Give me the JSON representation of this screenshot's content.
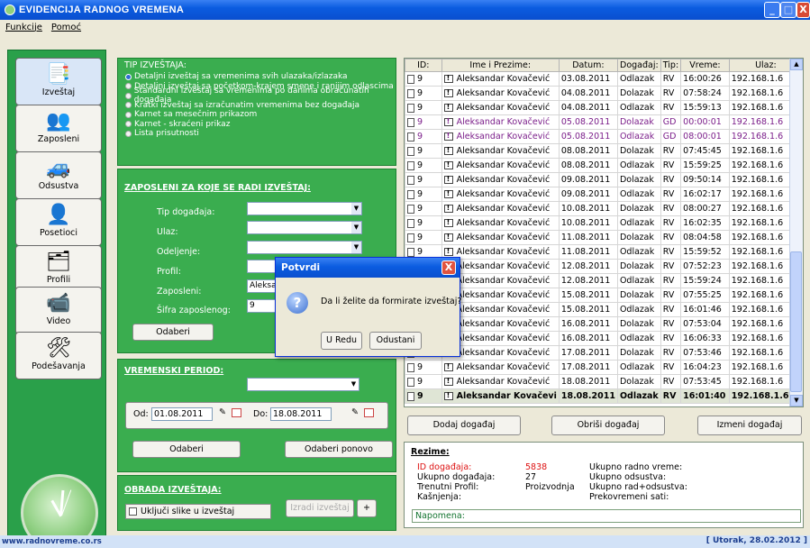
{
  "window": {
    "title": "EVIDENCIJA RADNOG VREMENA",
    "min": "_",
    "max": "□",
    "close": "X"
  },
  "menu": [
    "Funkcije",
    "Pomoć"
  ],
  "nav": [
    {
      "label": "Izveštaj",
      "icon": "📑"
    },
    {
      "label": "Zaposleni",
      "icon": "👥"
    },
    {
      "label": "Odsustva",
      "icon": "🚙"
    },
    {
      "label": "Posetioci",
      "icon": "👤"
    },
    {
      "label": "Profili",
      "icon": "🗂"
    },
    {
      "label": "Video",
      "icon": "📹"
    },
    {
      "label": "Podešavanja",
      "icon": "🛠"
    }
  ],
  "report_type": {
    "title": "TIP IZVEŠTAJA:",
    "options": [
      "Detaljni izveštaj sa vremenima svih ulazaka/izlazaka",
      "Detaljni izveštaj sa početkom-krajem smene i ranijim odlascima",
      "Standardni izveštaj sa vremenima po danima obračunatih događaja",
      "Kratki izveštaj sa izračunatim vremenima bez događaja",
      "Karnet sa mesečnim prikazom",
      "Karnet - skraćeni prikaz",
      "Lista prisutnosti"
    ],
    "selected_index": 0
  },
  "employees": {
    "header": "ZAPOSLENI ZA KOJE SE RADI IZVEŠTAJ:",
    "fields": [
      {
        "label": "Tip događaja:",
        "value": ""
      },
      {
        "label": "Ulaz:",
        "value": ""
      },
      {
        "label": "Odeljenje:",
        "value": ""
      },
      {
        "label": "Profil:",
        "value": ""
      },
      {
        "label": "Zaposleni:",
        "value": "Aleksan"
      },
      {
        "label": "Šifra zaposlenog:",
        "value": "9"
      }
    ],
    "select_button": "Odaberi"
  },
  "period": {
    "header": "VREMENSKI PERIOD:",
    "from_label": "Od:",
    "from": "01.08.2011",
    "to_label": "Do:",
    "to": "18.08.2011",
    "select_button": "Odaberi",
    "reselect_button": "Odaberi ponovo"
  },
  "processing": {
    "header": "OBRADA IZVEŠTAJA:",
    "checkbox_label": "Uključi slike u izveštaj",
    "make_button": "Izradi izveštaj",
    "plus_button": "+"
  },
  "events_table": {
    "columns": [
      "ID:",
      "Ime i Prezime:",
      "Datum:",
      "Događaj:",
      "Tip:",
      "Vreme:",
      "Ulaz:"
    ],
    "rows": [
      [
        "9",
        "Aleksandar Kovačević",
        "03.08.2011",
        "Odlazak",
        "RV",
        "16:00:26",
        "192.168.1.6"
      ],
      [
        "9",
        "Aleksandar Kovačević",
        "04.08.2011",
        "Dolazak",
        "RV",
        "07:58:24",
        "192.168.1.6"
      ],
      [
        "9",
        "Aleksandar Kovačević",
        "04.08.2011",
        "Odlazak",
        "RV",
        "15:59:13",
        "192.168.1.6"
      ],
      [
        "9",
        "Aleksandar Kovačević",
        "05.08.2011",
        "Dolazak",
        "GD",
        "00:00:01",
        "192.168.1.6"
      ],
      [
        "9",
        "Aleksandar Kovačević",
        "05.08.2011",
        "Odlazak",
        "GD",
        "08:00:01",
        "192.168.1.6"
      ],
      [
        "9",
        "Aleksandar Kovačević",
        "08.08.2011",
        "Dolazak",
        "RV",
        "07:45:45",
        "192.168.1.6"
      ],
      [
        "9",
        "Aleksandar Kovačević",
        "08.08.2011",
        "Odlazak",
        "RV",
        "15:59:25",
        "192.168.1.6"
      ],
      [
        "9",
        "Aleksandar Kovačević",
        "09.08.2011",
        "Dolazak",
        "RV",
        "09:50:14",
        "192.168.1.6"
      ],
      [
        "9",
        "Aleksandar Kovačević",
        "09.08.2011",
        "Odlazak",
        "RV",
        "16:02:17",
        "192.168.1.6"
      ],
      [
        "9",
        "Aleksandar Kovačević",
        "10.08.2011",
        "Dolazak",
        "RV",
        "08:00:27",
        "192.168.1.6"
      ],
      [
        "9",
        "Aleksandar Kovačević",
        "10.08.2011",
        "Odlazak",
        "RV",
        "16:02:35",
        "192.168.1.6"
      ],
      [
        "9",
        "Aleksandar Kovačević",
        "11.08.2011",
        "Dolazak",
        "RV",
        "08:04:58",
        "192.168.1.6"
      ],
      [
        "9",
        "Aleksandar Kovačević",
        "11.08.2011",
        "Odlazak",
        "RV",
        "15:59:52",
        "192.168.1.6"
      ],
      [
        "9",
        "Aleksandar Kovačević",
        "12.08.2011",
        "Dolazak",
        "RV",
        "07:52:23",
        "192.168.1.6"
      ],
      [
        "9",
        "Aleksandar Kovačević",
        "12.08.2011",
        "Odlazak",
        "RV",
        "15:59:24",
        "192.168.1.6"
      ],
      [
        "9",
        "Aleksandar Kovačević",
        "15.08.2011",
        "Dolazak",
        "RV",
        "07:55:25",
        "192.168.1.6"
      ],
      [
        "9",
        "Aleksandar Kovačević",
        "15.08.2011",
        "Odlazak",
        "RV",
        "16:01:46",
        "192.168.1.6"
      ],
      [
        "9",
        "Aleksandar Kovačević",
        "16.08.2011",
        "Dolazak",
        "RV",
        "07:53:04",
        "192.168.1.6"
      ],
      [
        "9",
        "Aleksandar Kovačević",
        "16.08.2011",
        "Odlazak",
        "RV",
        "16:06:33",
        "192.168.1.6"
      ],
      [
        "9",
        "Aleksandar Kovačević",
        "17.08.2011",
        "Dolazak",
        "RV",
        "07:53:46",
        "192.168.1.6"
      ],
      [
        "9",
        "Aleksandar Kovačević",
        "17.08.2011",
        "Odlazak",
        "RV",
        "16:04:23",
        "192.168.1.6"
      ],
      [
        "9",
        "Aleksandar Kovačević",
        "18.08.2011",
        "Dolazak",
        "RV",
        "07:53:45",
        "192.168.1.6"
      ],
      [
        "9",
        "Aleksandar Kovačevi",
        "18.08.2011",
        "Odlazak",
        "RV",
        "16:01:40",
        "192.168.1.6"
      ]
    ],
    "purple_rows": [
      3,
      4
    ],
    "selected_row": 22
  },
  "event_buttons": {
    "add": "Dodaj događaj",
    "delete": "Obriši događaj",
    "edit": "Izmeni događaj"
  },
  "summary": {
    "title": "Rezime:",
    "id_label": "ID događaja:",
    "id_value": "5838",
    "count_label": "Ukupno događaja:",
    "count_value": "27",
    "profile_label": "Trenutni Profil:",
    "profile_value": "Proizvodnja",
    "late_label": "Kašnjenja:",
    "work_label": "Ukupno radno vreme:",
    "absence_label": "Ukupno odsustva:",
    "work_absence_label": "Ukupno rad+odsustva:",
    "overtime_label": "Prekovremeni sati:",
    "note_label": "Napomena:"
  },
  "dialog": {
    "title": "Potvrdi",
    "message": "Da li želite da formirate izveštaj?",
    "ok": "U Redu",
    "cancel": "Odustani",
    "close": "X"
  },
  "status": {
    "website": "www.radnovreme.co.rs",
    "date": "[ Utorak, 28.02.2012 ]"
  },
  "colors": {
    "panel_green": "#3aad4f",
    "title_blue": "#0b5ce0",
    "purple_text": "#7b1e8a"
  }
}
